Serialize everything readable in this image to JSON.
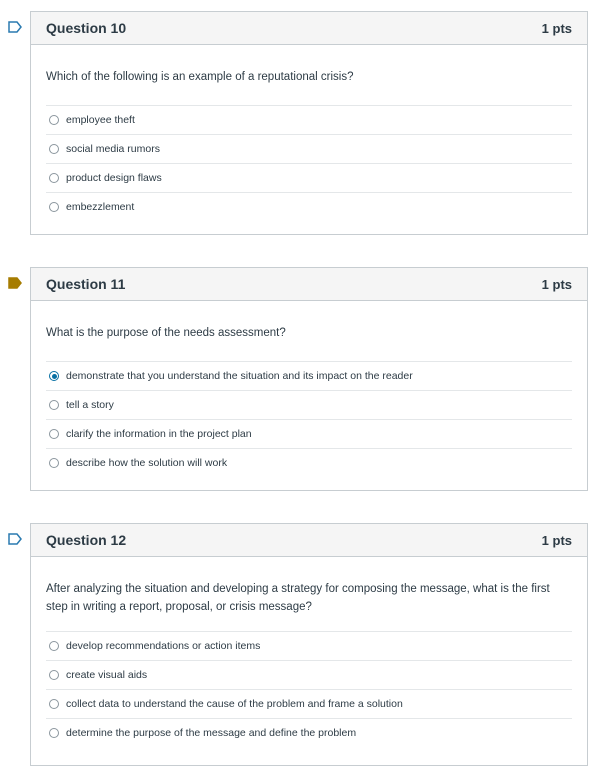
{
  "questions": [
    {
      "title": "Question 10",
      "points": "1 pts",
      "text": "Which of the following is an example of a reputational crisis?",
      "flagged": false,
      "answers": [
        "employee theft",
        "social media rumors",
        "product design flaws",
        "embezzlement"
      ],
      "selected_index": null
    },
    {
      "title": "Question 11",
      "points": "1 pts",
      "text": "What is the purpose of the needs assessment?",
      "flagged": true,
      "answers": [
        "demonstrate that you understand the situation and its impact on the reader",
        "tell a story",
        "clarify the information in the project plan",
        "describe how the solution will work"
      ],
      "selected_index": 0
    },
    {
      "title": "Question 12",
      "points": "1 pts",
      "text": "After analyzing the situation and developing a strategy for composing the message, what is the first step in writing a report, proposal, or crisis message?",
      "flagged": false,
      "answers": [
        "develop recommendations or action items",
        "create visual aids",
        "collect data to understand the cause of the problem and frame a solution",
        "determine the purpose of the message and define the problem"
      ],
      "selected_index": null
    }
  ],
  "colors": {
    "flag_unflagged": "#2a7ab0",
    "flag_flagged": "#a67c00",
    "radio_selected": "#0770a3"
  }
}
